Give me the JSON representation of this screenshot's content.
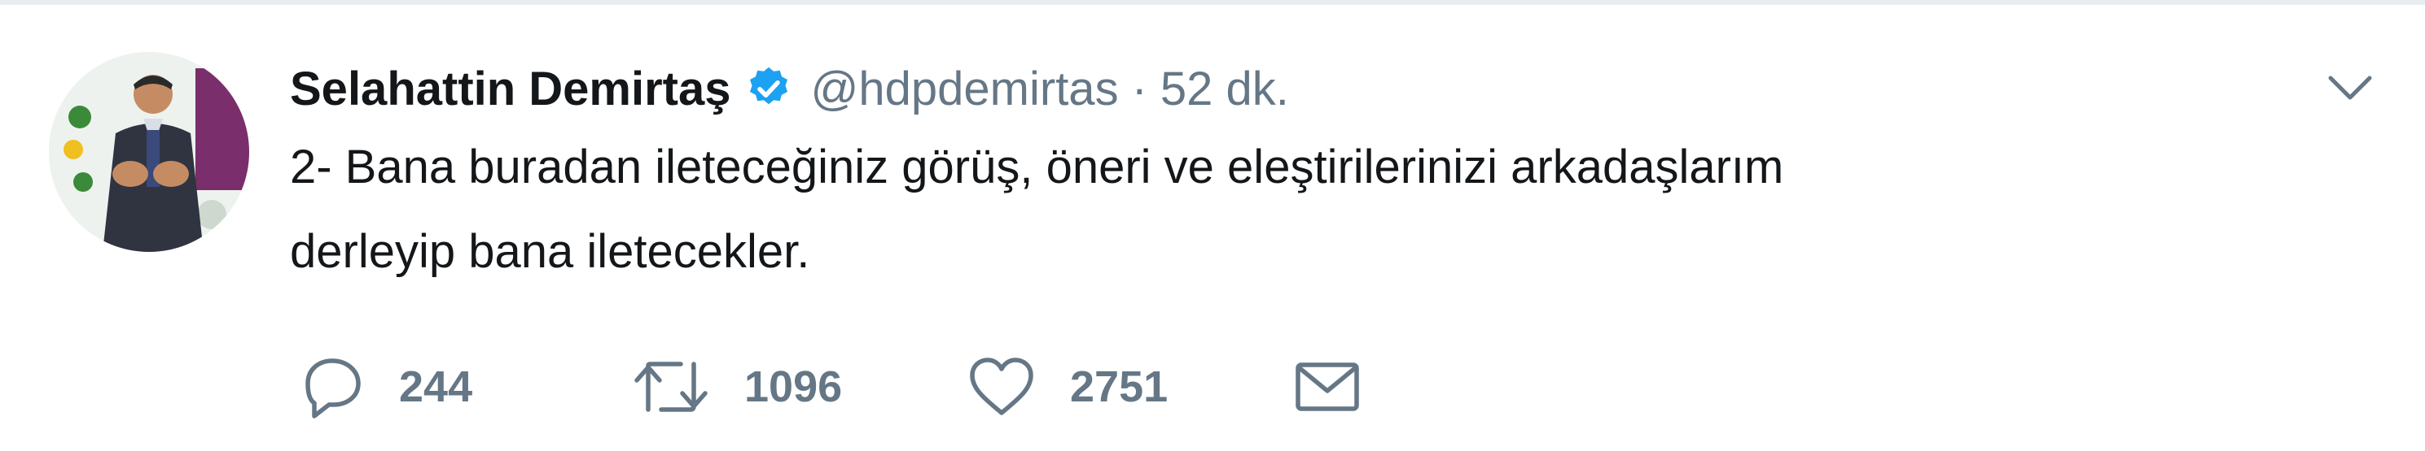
{
  "tweet": {
    "author": {
      "display_name": "Selahattin Demirtaş",
      "handle": "@hdpdemirtas",
      "verified": true,
      "avatar_icon": "profile-photo"
    },
    "separator": "·",
    "timestamp": "52 dk.",
    "text": "2- Bana buradan ileteceğiniz görüş, öneri ve eleştirilerinizi arkadaşlarım\nderleyip bana iletecekler.",
    "actions": {
      "reply": {
        "icon": "reply-icon",
        "count": "244"
      },
      "retweet": {
        "icon": "retweet-icon",
        "count": "1096"
      },
      "like": {
        "icon": "heart-icon",
        "count": "2751"
      },
      "message": {
        "icon": "envelope-icon"
      }
    },
    "menu_icon": "chevron-down-icon"
  },
  "colors": {
    "text_primary": "#14171a",
    "text_secondary": "#657786",
    "verified_blue": "#1da1f2",
    "divider": "#e6ecf0"
  }
}
